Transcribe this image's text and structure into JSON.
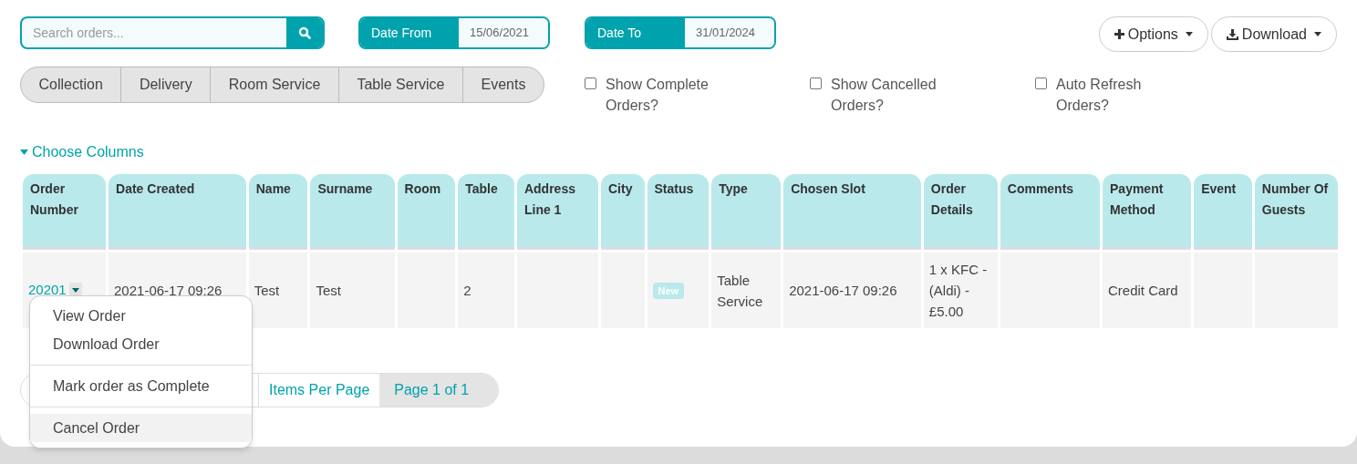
{
  "search": {
    "placeholder": "Search orders..."
  },
  "date_from": {
    "label": "Date From",
    "value": "15/06/2021"
  },
  "date_to": {
    "label": "Date To",
    "value": "31/01/2024"
  },
  "actions": [
    {
      "label": "Options",
      "kind": "plus"
    },
    {
      "label": "Download",
      "kind": "download"
    }
  ],
  "order_types": [
    {
      "label": "Collection",
      "selected": false
    },
    {
      "label": "Delivery",
      "selected": false
    },
    {
      "label": "Room Service",
      "selected": false
    },
    {
      "label": "Table Service",
      "selected": false
    },
    {
      "label": "Events",
      "selected": false
    }
  ],
  "filters": [
    {
      "label": "Show Complete Orders?",
      "checked": false
    },
    {
      "label": "Show Cancelled Orders?",
      "checked": false
    },
    {
      "label": "Auto Refresh Orders?",
      "checked": false
    }
  ],
  "choose_columns": {
    "label": "Choose Columns",
    "expanded": true
  },
  "table": {
    "columns": [
      "Order Number",
      "Date Created",
      "Name",
      "Surname",
      "Room",
      "Table",
      "Address Line 1",
      "City",
      "Status",
      "Type",
      "Chosen Slot",
      "Order Details",
      "Comments",
      "Payment Method",
      "Event",
      "Number Of Guests"
    ],
    "rows": [
      {
        "cells": [
          "20201",
          "2021-06-17 09:26",
          "Test",
          "Test",
          "",
          "2",
          "",
          "",
          "New",
          "Table Service",
          "2021-06-17 09:26",
          "1 x KFC - (Aldi) - £5.00",
          "",
          "Credit Card",
          "",
          ""
        ]
      }
    ]
  },
  "row_menu": {
    "groups": [
      [
        {
          "label": "View Order",
          "highlighted": false
        },
        {
          "label": "Download Order",
          "highlighted": false
        }
      ],
      [
        {
          "label": "Mark order as Complete",
          "highlighted": false
        }
      ],
      [
        {
          "label": "Cancel Order",
          "highlighted": true
        }
      ]
    ]
  },
  "pagination": {
    "items_per_page": "Items Per Page",
    "page": "Page 1 of 1"
  }
}
